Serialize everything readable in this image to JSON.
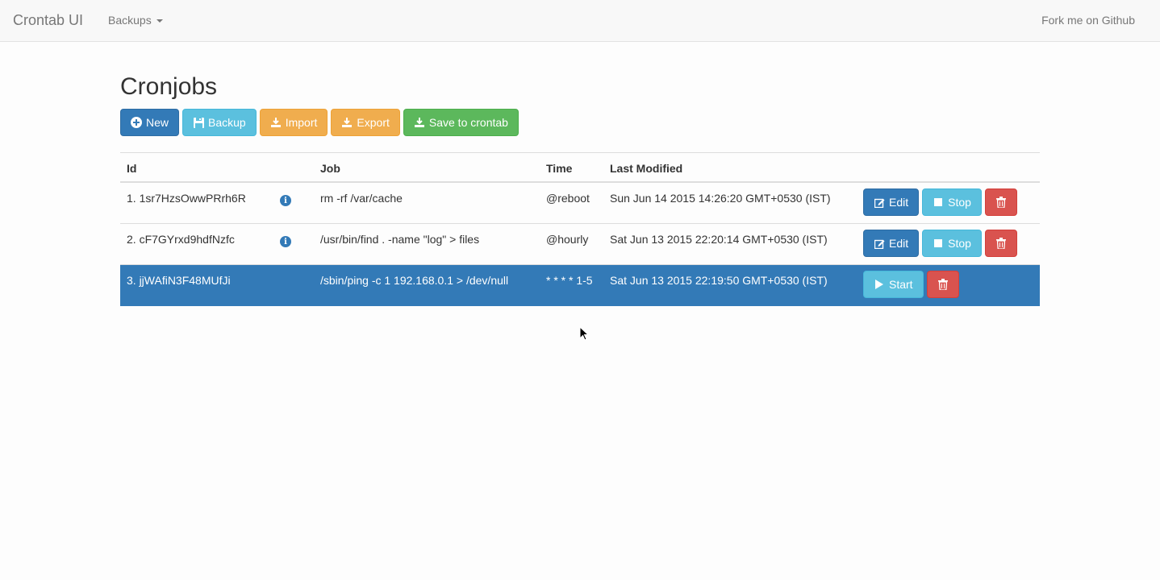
{
  "navbar": {
    "brand": "Crontab UI",
    "backups_label": "Backups",
    "fork_label": "Fork me on Github"
  },
  "page": {
    "title": "Cronjobs"
  },
  "toolbar": {
    "new_label": "New",
    "backup_label": "Backup",
    "import_label": "Import",
    "export_label": "Export",
    "save_label": "Save to crontab"
  },
  "table": {
    "headers": {
      "id": "Id",
      "job": "Job",
      "time": "Time",
      "last_modified": "Last Modified"
    },
    "rows": [
      {
        "id": "1. 1sr7HzsOwwPRrh6R",
        "info_icon": "info-icon",
        "job": "rm -rf /var/cache",
        "time": "@reboot",
        "modified": "Sun Jun 14 2015 14:26:20 GMT+0530 (IST)",
        "edit_label": "Edit",
        "stop_label": "Stop"
      },
      {
        "id": "2. cF7GYrxd9hdfNzfc",
        "info_icon": "info-icon",
        "job": "/usr/bin/find . -name \"log\" > files",
        "time": "@hourly",
        "modified": "Sat Jun 13 2015 22:20:14 GMT+0530 (IST)",
        "edit_label": "Edit",
        "stop_label": "Stop"
      },
      {
        "id": "3. jjWAfiN3F48MUfJi",
        "job": "/sbin/ping -c 1 192.168.0.1 > /dev/null",
        "time": "* * * * 1-5",
        "modified": "Sat Jun 13 2015 22:19:50 GMT+0530 (IST)",
        "start_label": "Start"
      }
    ]
  },
  "colors": {
    "primary": "#337ab7",
    "info": "#5bc0de",
    "warning": "#f0ad4e",
    "success": "#5cb85c",
    "danger": "#d9534f"
  }
}
